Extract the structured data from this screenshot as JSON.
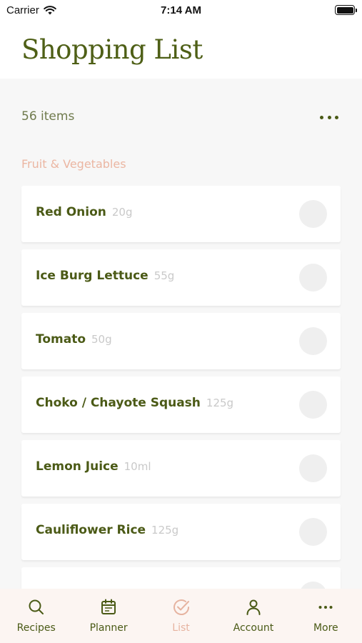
{
  "status_bar": {
    "carrier": "Carrier",
    "time": "7:14 AM"
  },
  "header": {
    "title": "Shopping List"
  },
  "summary": {
    "count": "56 items"
  },
  "section": {
    "title": "Fruit & Vegetables"
  },
  "items": [
    {
      "name": "Red Onion",
      "qty": "20g"
    },
    {
      "name": "Ice Burg Lettuce",
      "qty": "55g"
    },
    {
      "name": "Tomato",
      "qty": "50g"
    },
    {
      "name": "Choko / Chayote Squash",
      "qty": "125g"
    },
    {
      "name": "Lemon Juice",
      "qty": "10ml"
    },
    {
      "name": "Cauliflower Rice",
      "qty": "125g"
    },
    {
      "name": "",
      "qty": ""
    }
  ],
  "tabs": [
    {
      "label": "Recipes",
      "icon": "search-icon"
    },
    {
      "label": "Planner",
      "icon": "calendar-icon"
    },
    {
      "label": "List",
      "icon": "check-circle-icon",
      "active": true
    },
    {
      "label": "Account",
      "icon": "person-icon"
    },
    {
      "label": "More",
      "icon": "more-icon"
    }
  ],
  "colors": {
    "accent": "#4b5a16",
    "section": "#ebb6a2",
    "active_tab": "#e6b3a0",
    "tabbar_bg": "#fcf5f2"
  }
}
